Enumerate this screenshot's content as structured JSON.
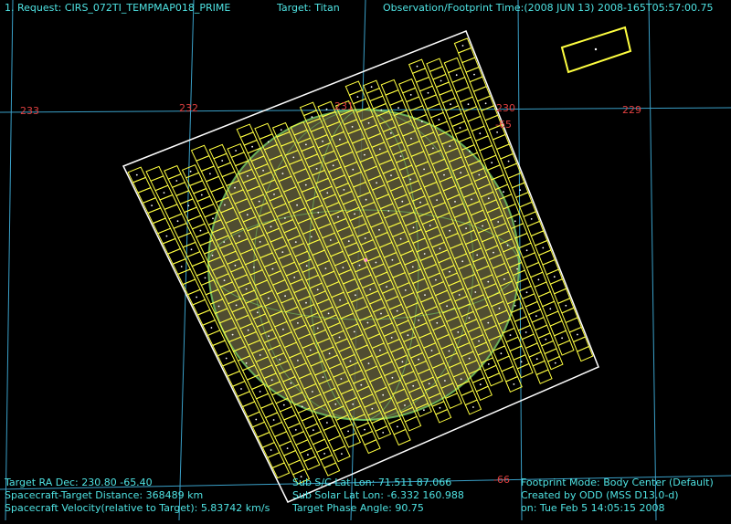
{
  "header": {
    "request": "1. Request: CIRS_072TI_TEMPMAP018_PRIME",
    "target": "Target: Titan",
    "time": "Observation/Footprint Time:(2008 JUN 13) 2008-165T05:57:00.75"
  },
  "grid_labels": {
    "ra_233": "233",
    "ra_232": "232",
    "ra_231": "231",
    "ra_230": "230",
    "ra_229": "229",
    "dec_65": "-65",
    "dec_66": "-66"
  },
  "footer": {
    "left": {
      "ra_dec": "Target RA Dec: 230.80 -65.40",
      "distance": "Spacecraft-Target Distance:  368489 km",
      "velocity": "Spacecraft Velocity(relative to Target): 5.83742 km/s"
    },
    "middle": {
      "sub_sc": "Sub S/C Lat Lon: 71.511  87.066",
      "sub_solar": "Sub Solar Lat Lon: -6.332  160.988",
      "phase": "Target Phase Angle: 90.75"
    },
    "right": {
      "mode": "Footprint Mode: Body Center (Default)",
      "created": "Created by ODD (MSS D13.0-d)",
      "on": "on: Tue Feb  5 14:05:15 2008"
    }
  },
  "colors": {
    "background": "#000000",
    "grid": "#3aa0c8",
    "grid_label": "#e04040",
    "footprint": "#ffff40",
    "footprint_outline": "#ffffff",
    "titan": "#5e5a3a",
    "hud_text": "#4fe3e3"
  }
}
